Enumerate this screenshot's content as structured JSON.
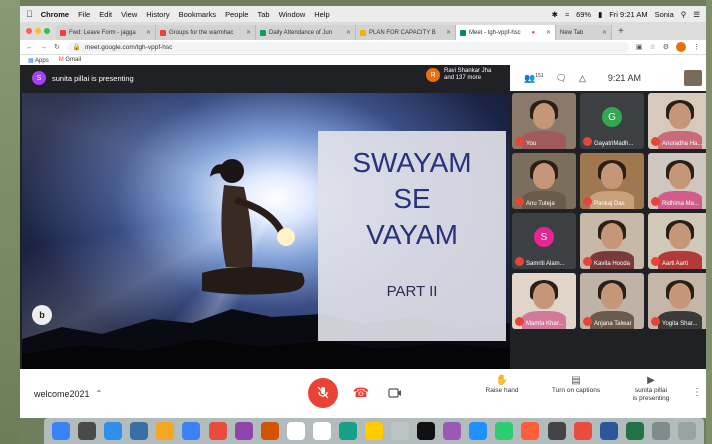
{
  "menubar": {
    "apple": "",
    "items": [
      "Chrome",
      "File",
      "Edit",
      "View",
      "History",
      "Bookmarks",
      "People",
      "Tab",
      "Window",
      "Help"
    ],
    "battery": "69%",
    "clock": "Fri 9:21 AM",
    "user": "Sonia"
  },
  "tabs": [
    {
      "label": "Fwd: Leave Form - jagga",
      "color": "#ea4335"
    },
    {
      "label": "Groups for the warmhac",
      "color": "#ea4335"
    },
    {
      "label": "Daily Attendance of Jun",
      "color": "#0f9d58"
    },
    {
      "label": "PLAN FOR CAPACITY B",
      "color": "#f4b400"
    },
    {
      "label": "Meet - tgh-vppf-hsc",
      "color": "#00897b"
    },
    {
      "label": "New Tab",
      "color": "#9aa0a6"
    }
  ],
  "address": {
    "url": "meet.google.com/tgh-vppf-hsc"
  },
  "bookmarks": {
    "apps": "Apps",
    "gmail": "Gmail"
  },
  "meet": {
    "presenter_initial": "S",
    "presenting_text": "sunita pillai is presenting",
    "people_initial": "R",
    "people_line1": "Ravi Shankar Jha",
    "people_line2": "and 137 more",
    "participants_count": "151",
    "time": "9:21 AM"
  },
  "slide": {
    "line1": "SWAYAM",
    "line2": "SE",
    "line3": "VAYAM",
    "part": "PART II",
    "logo": "b"
  },
  "participants": [
    {
      "name": "You",
      "type": "video",
      "bg": "#8a7a6c",
      "body": "#a05a5a"
    },
    {
      "name": "GayatriMadh...",
      "type": "letter",
      "letter": "G",
      "letter_bg": "#33a852",
      "bg": "#3c4043"
    },
    {
      "name": "Anuradha Ha...",
      "type": "video",
      "bg": "#d8c9bd",
      "body": "#c96a7a"
    },
    {
      "name": "Anu Tuteja",
      "type": "video",
      "bg": "#7c6e5c",
      "body": "#6a5a4a"
    },
    {
      "name": "Pankaj Das",
      "type": "video",
      "bg": "#a07850",
      "body": "#caa07a"
    },
    {
      "name": "Ridhima Ma...",
      "type": "video",
      "bg": "#cfc6c0",
      "body": "#d15c8a"
    },
    {
      "name": "Samriti Alam...",
      "type": "letter",
      "letter": "S",
      "letter_bg": "#e52592",
      "bg": "#3c4043"
    },
    {
      "name": "Kavita Hooda",
      "type": "video",
      "bg": "#c7b8a8",
      "body": "#7a3a3a"
    },
    {
      "name": "Aarti Aarti",
      "type": "video",
      "bg": "#d0c8b8",
      "body": "#b33a3a"
    },
    {
      "name": "Mamta Khar...",
      "type": "video",
      "bg": "#e0d5c8",
      "body": "#d17a9a"
    },
    {
      "name": "Anjana Talwar",
      "type": "video",
      "bg": "#bfb2a6",
      "body": "#6a5a4a"
    },
    {
      "name": "Yogita Shar...",
      "type": "video",
      "bg": "#c4b7aa",
      "body": "#3a3a3a"
    }
  ],
  "controls": {
    "meeting_code": "welcome2021",
    "raise_hand": "Raise hand",
    "captions": "Turn on captions",
    "presenting_line1": "sunita pillai",
    "presenting_line2": "is presenting"
  },
  "colors": {
    "mic_off": "#ea4335",
    "meet_bg": "#202124"
  },
  "dock": [
    "#3b82f6",
    "#4a4a4a",
    "#2e8ee8",
    "#3a6ea5",
    "#f5a623",
    "#3b82f6",
    "#e74c3c",
    "#8e44ad",
    "#d35400",
    "#ffffff",
    "#ffffff",
    "#16a085",
    "#ffcc00",
    "#bdc3c7",
    "#111111",
    "#9b59b6",
    "#1e90ff",
    "#2ecc71",
    "#ff5e3a",
    "#444444",
    "#e74c3c",
    "#2b579a",
    "#217346",
    "#7f8c8d",
    "#95a5a6"
  ]
}
